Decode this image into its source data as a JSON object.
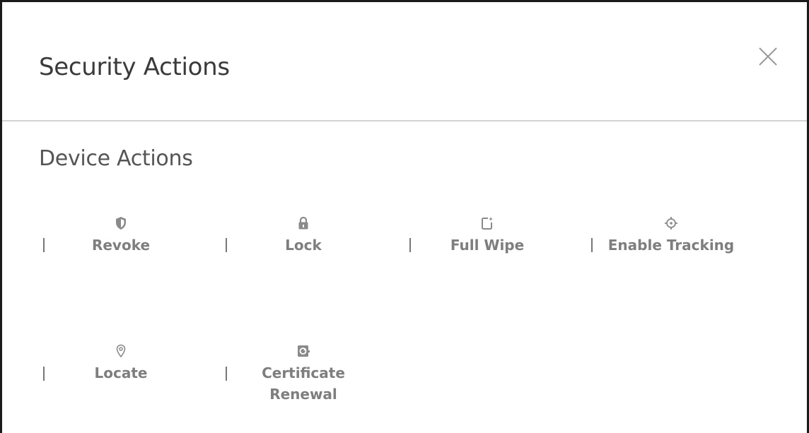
{
  "dialog": {
    "title": "Security Actions",
    "close_icon": "close-icon"
  },
  "section": {
    "title": "Device Actions"
  },
  "actions": [
    {
      "label": "Revoke",
      "icon": "shield-icon"
    },
    {
      "label": "Lock",
      "icon": "lock-icon"
    },
    {
      "label": "Full Wipe",
      "icon": "wipe-device-icon"
    },
    {
      "label": "Enable Tracking",
      "icon": "crosshair-icon"
    },
    {
      "label": "Locate",
      "icon": "location-pin-icon"
    },
    {
      "label": "Certificate Renewal",
      "icon": "certificate-icon"
    }
  ],
  "colors": {
    "title_text": "#3a3a3a",
    "action_text": "#7e7e7e",
    "icon": "#8a8a8a",
    "divider": "#d3d3d3"
  }
}
